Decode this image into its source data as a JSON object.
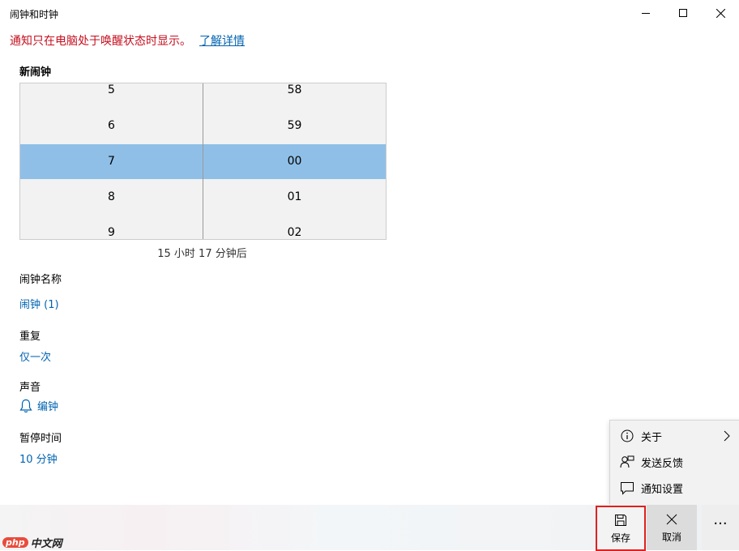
{
  "window": {
    "title": "闹钟和时钟"
  },
  "notice": {
    "text": "通知只在电脑处于唤醒状态时显示。",
    "link": "了解详情"
  },
  "alarm": {
    "section_title": "新闹钟",
    "hours": [
      "5",
      "6",
      "7",
      "8",
      "9"
    ],
    "minutes": [
      "58",
      "59",
      "00",
      "01",
      "02"
    ],
    "selected_hour": "7",
    "selected_minute": "00",
    "countdown": "15 小时 17 分钟后",
    "selection_color": "#8fbfe7"
  },
  "fields": {
    "name_label": "闹钟名称",
    "name_value": "闹钟 (1)",
    "repeat_label": "重复",
    "repeat_value": "仅一次",
    "sound_label": "声音",
    "sound_value": "编钟",
    "sound_icon": "bell-icon",
    "snooze_label": "暂停时间",
    "snooze_value": "10 分钟"
  },
  "menu": {
    "items": [
      {
        "label": "关于",
        "icon": "info-icon",
        "has_submenu": true
      },
      {
        "label": "发送反馈",
        "icon": "feedback-icon",
        "has_submenu": false
      },
      {
        "label": "通知设置",
        "icon": "message-icon",
        "has_submenu": false
      }
    ]
  },
  "commandbar": {
    "save_label": "保存",
    "cancel_label": "取消",
    "more_label": "···",
    "highlight_color": "#e02020"
  },
  "watermark": {
    "badge": "php",
    "text": "中文网"
  },
  "colors": {
    "accent": "#0063b1",
    "warning": "#c50f1f"
  }
}
